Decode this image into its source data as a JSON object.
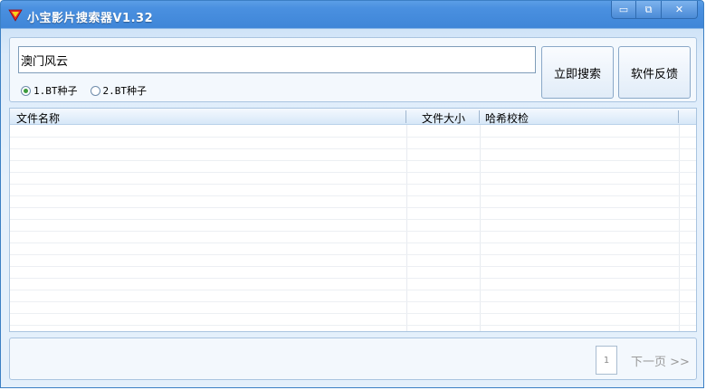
{
  "window": {
    "title": "小宝影片搜索器V1.32",
    "controls": {
      "minimize": "▭",
      "restore": "⧉",
      "close": "✕"
    }
  },
  "search": {
    "query": "澳门风云",
    "radios": [
      {
        "label": "1.BT种子",
        "checked": true
      },
      {
        "label": "2.BT种子",
        "checked": false
      }
    ],
    "search_button": "立即搜索",
    "feedback_button": "软件反馈"
  },
  "table": {
    "columns": [
      "文件名称",
      "文件大小",
      "哈希校检"
    ],
    "rows": []
  },
  "pagination": {
    "current_page": "1",
    "next_label": "下一页 >>"
  },
  "colors": {
    "title_bar": "#4a90e0",
    "panel_border": "#a9c4e0"
  },
  "icons": {
    "app": "superman-s-icon"
  }
}
